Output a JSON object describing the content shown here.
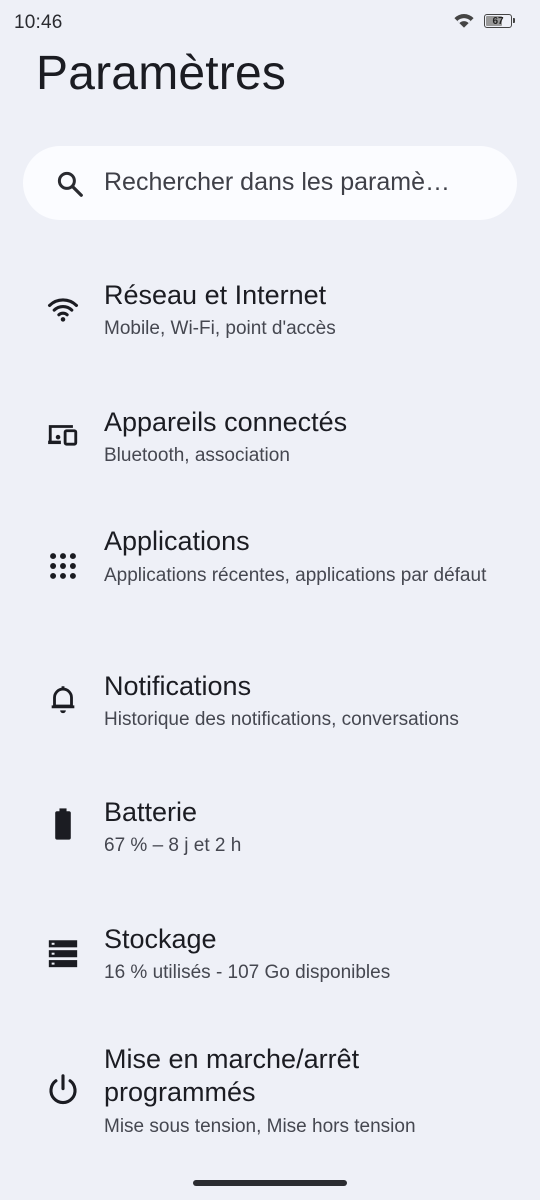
{
  "status_bar": {
    "time": "10:46",
    "battery_level": "67",
    "battery_fraction": 0.67
  },
  "page": {
    "title": "Paramètres"
  },
  "search": {
    "placeholder": "Rechercher dans les paramè…"
  },
  "settings": [
    {
      "title": "Réseau et Internet",
      "subtitle": "Mobile, Wi-Fi, point d'accès",
      "icon": "wifi-icon"
    },
    {
      "title": "Appareils connectés",
      "subtitle": "Bluetooth, association",
      "icon": "connected-devices-icon"
    },
    {
      "title": "Applications",
      "subtitle": "Applications récentes, applications par défaut",
      "icon": "apps-grid-icon"
    },
    {
      "title": "Notifications",
      "subtitle": "Historique des notifications, conversations",
      "icon": "bell-icon"
    },
    {
      "title": "Batterie",
      "subtitle": "67 % – 8 j et 2 h",
      "icon": "battery-icon"
    },
    {
      "title": "Stockage",
      "subtitle": "16 % utilisés - 107 Go disponibles",
      "icon": "storage-icon"
    },
    {
      "title": "Mise en marche/arrêt programmés",
      "subtitle": "Mise sous tension, Mise hors tension",
      "icon": "power-icon"
    }
  ],
  "colors": {
    "background": "#eef0f7",
    "search_background": "#fbfcff",
    "text_primary": "#1b1c22",
    "text_secondary": "#454750"
  }
}
